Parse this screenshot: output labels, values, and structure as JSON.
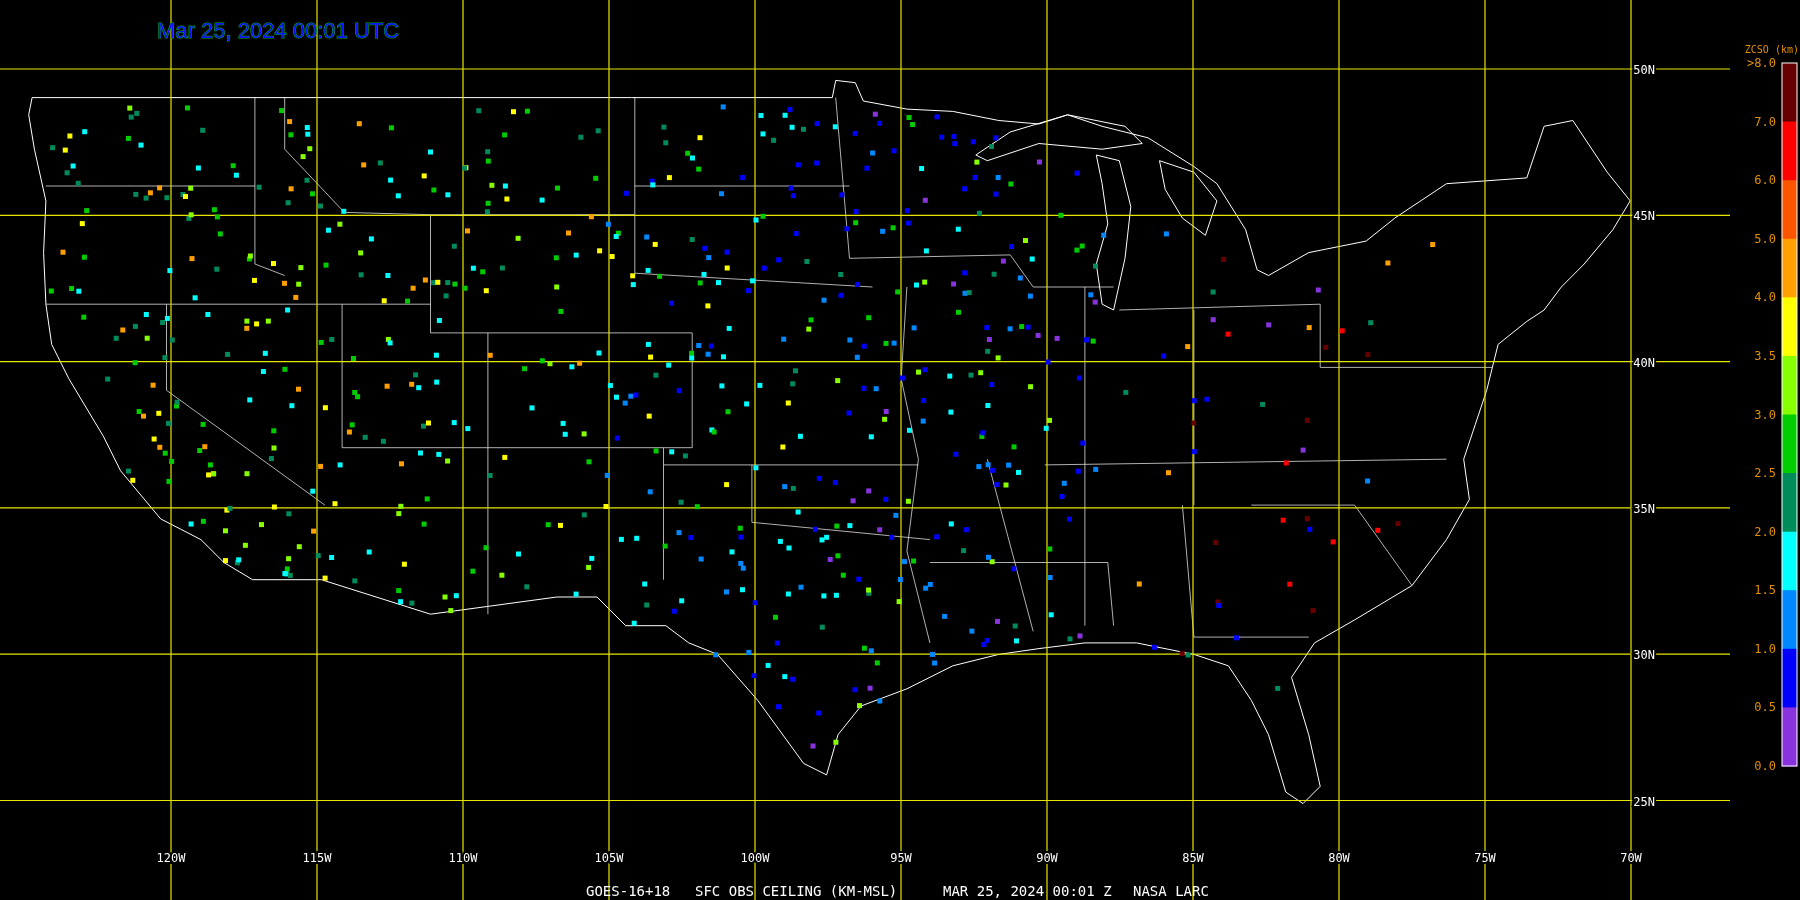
{
  "title": "Mar 25, 2024 00:01 UTC",
  "map": {
    "latitude_labels": [
      "50N",
      "45N",
      "40N",
      "35N",
      "30N",
      "25N"
    ],
    "longitude_labels": [
      "120W",
      "115W",
      "110W",
      "105W",
      "100W",
      "95W",
      "90W",
      "85W",
      "80W",
      "75W",
      "70W"
    ]
  },
  "legend": {
    "title": "ZCSO (km)",
    "labels": [
      ">8.0",
      "7.0",
      "6.0",
      "5.0",
      "4.0",
      "3.5",
      "3.0",
      "2.5",
      "2.0",
      "1.5",
      "1.0",
      "0.5",
      "0.0"
    ],
    "bins": [
      {
        "color": "#660000"
      },
      {
        "color": "#ff0000"
      },
      {
        "color": "#ff5500"
      },
      {
        "color": "#ffa000"
      },
      {
        "color": "#ffff00"
      },
      {
        "color": "#88ff00"
      },
      {
        "color": "#00cc00"
      },
      {
        "color": "#008c5a"
      },
      {
        "color": "#00ffff"
      },
      {
        "color": "#0088ff"
      },
      {
        "color": "#0000ff"
      },
      {
        "color": "#8833dd"
      }
    ]
  },
  "caption": [
    "GOES-16+18",
    "SFC OBS CEILING (KM-MSL)",
    "MAR 25, 2024 00:01 Z",
    "NASA LARC"
  ]
}
